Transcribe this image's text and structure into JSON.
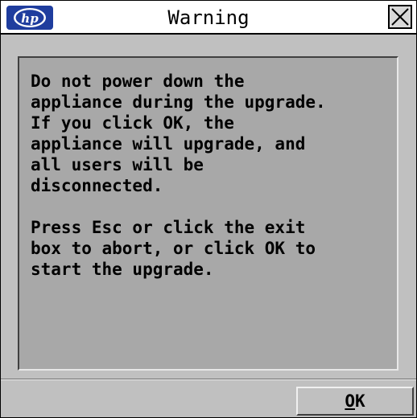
{
  "dialog": {
    "title": "Warning",
    "logo_icon": "hp-logo-icon",
    "close_icon": "close-x-icon",
    "message_lines": [
      "Do not power down the",
      "appliance during the upgrade.",
      "If you click OK, the",
      "appliance will upgrade, and",
      "all users will be",
      "disconnected."
    ],
    "message2_lines": [
      "Press Esc or click the exit",
      "box to abort, or click OK to",
      "start the upgrade."
    ],
    "ok_button": {
      "mnemonic": "O",
      "rest": "K"
    }
  },
  "colors": {
    "window_bg": "#c0c0c0",
    "panel_bg": "#a8a8a8",
    "titlebar_bg": "#ffffff",
    "logo_blue": "#1f3d9e"
  }
}
